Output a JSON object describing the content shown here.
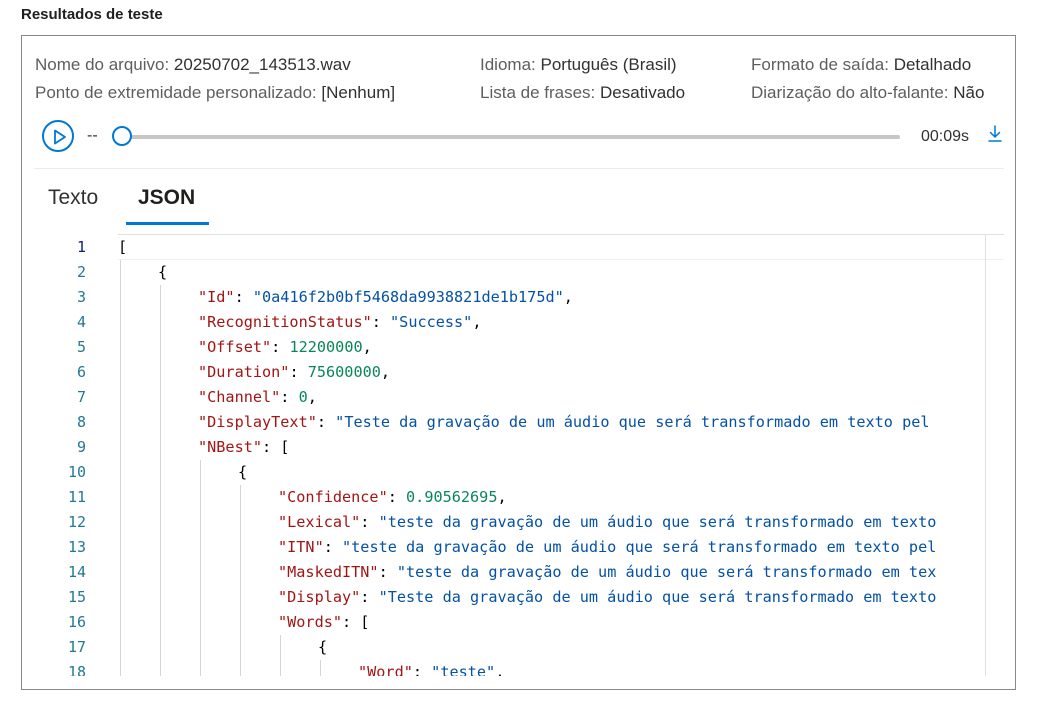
{
  "section_title": "Resultados de teste",
  "meta": {
    "file_label": "Nome do arquivo:",
    "file_value": "20250702_143513.wav",
    "lang_label": "Idioma:",
    "lang_value": "Português (Brasil)",
    "format_label": "Formato de saída:",
    "format_value": "Detalhado",
    "endpoint_label": "Ponto de extremidade personalizado:",
    "endpoint_value": "[Nenhum]",
    "phrases_label": "Lista de frases:",
    "phrases_value": "Desativado",
    "diar_label": "Diarização do alto-falante:",
    "diar_value": "Não"
  },
  "player": {
    "current_time": "--",
    "duration": "00:09s",
    "progress": 0,
    "play_icon": "play-icon",
    "download_icon": "download-icon"
  },
  "tabs": [
    {
      "label": "Texto",
      "active": false
    },
    {
      "label": "JSON",
      "active": true
    }
  ],
  "editor": {
    "active_line": 1,
    "lines": [
      {
        "n": "1",
        "indent": 0,
        "tokens": [
          [
            "punc",
            "["
          ]
        ]
      },
      {
        "n": "2",
        "indent": 1,
        "tokens": [
          [
            "punc",
            "{"
          ]
        ]
      },
      {
        "n": "3",
        "indent": 2,
        "tokens": [
          [
            "key",
            "\"Id\""
          ],
          [
            "punc",
            ": "
          ],
          [
            "str",
            "\"0a416f2b0bf5468da9938821de1b175d\""
          ],
          [
            "punc",
            ","
          ]
        ]
      },
      {
        "n": "4",
        "indent": 2,
        "tokens": [
          [
            "key",
            "\"RecognitionStatus\""
          ],
          [
            "punc",
            ": "
          ],
          [
            "str",
            "\"Success\""
          ],
          [
            "punc",
            ","
          ]
        ]
      },
      {
        "n": "5",
        "indent": 2,
        "tokens": [
          [
            "key",
            "\"Offset\""
          ],
          [
            "punc",
            ": "
          ],
          [
            "num",
            "12200000"
          ],
          [
            "punc",
            ","
          ]
        ]
      },
      {
        "n": "6",
        "indent": 2,
        "tokens": [
          [
            "key",
            "\"Duration\""
          ],
          [
            "punc",
            ": "
          ],
          [
            "num",
            "75600000"
          ],
          [
            "punc",
            ","
          ]
        ]
      },
      {
        "n": "7",
        "indent": 2,
        "tokens": [
          [
            "key",
            "\"Channel\""
          ],
          [
            "punc",
            ": "
          ],
          [
            "num",
            "0"
          ],
          [
            "punc",
            ","
          ]
        ]
      },
      {
        "n": "8",
        "indent": 2,
        "tokens": [
          [
            "key",
            "\"DisplayText\""
          ],
          [
            "punc",
            ": "
          ],
          [
            "str",
            "\"Teste da gravação de um áudio que será transformado em texto pel"
          ]
        ]
      },
      {
        "n": "9",
        "indent": 2,
        "tokens": [
          [
            "key",
            "\"NBest\""
          ],
          [
            "punc",
            ": ["
          ]
        ]
      },
      {
        "n": "10",
        "indent": 3,
        "tokens": [
          [
            "punc",
            "{"
          ]
        ]
      },
      {
        "n": "11",
        "indent": 4,
        "tokens": [
          [
            "key",
            "\"Confidence\""
          ],
          [
            "punc",
            ": "
          ],
          [
            "num",
            "0.90562695"
          ],
          [
            "punc",
            ","
          ]
        ]
      },
      {
        "n": "12",
        "indent": 4,
        "tokens": [
          [
            "key",
            "\"Lexical\""
          ],
          [
            "punc",
            ": "
          ],
          [
            "str",
            "\"teste da gravação de um áudio que será transformado em texto"
          ]
        ]
      },
      {
        "n": "13",
        "indent": 4,
        "tokens": [
          [
            "key",
            "\"ITN\""
          ],
          [
            "punc",
            ": "
          ],
          [
            "str",
            "\"teste da gravação de um áudio que será transformado em texto pel"
          ]
        ]
      },
      {
        "n": "14",
        "indent": 4,
        "tokens": [
          [
            "key",
            "\"MaskedITN\""
          ],
          [
            "punc",
            ": "
          ],
          [
            "str",
            "\"teste da gravação de um áudio que será transformado em tex"
          ]
        ]
      },
      {
        "n": "15",
        "indent": 4,
        "tokens": [
          [
            "key",
            "\"Display\""
          ],
          [
            "punc",
            ": "
          ],
          [
            "str",
            "\"Teste da gravação de um áudio que será transformado em texto"
          ]
        ]
      },
      {
        "n": "16",
        "indent": 4,
        "tokens": [
          [
            "key",
            "\"Words\""
          ],
          [
            "punc",
            ": ["
          ]
        ]
      },
      {
        "n": "17",
        "indent": 5,
        "tokens": [
          [
            "punc",
            "{"
          ]
        ]
      },
      {
        "n": "18",
        "indent": 6,
        "tokens": [
          [
            "key",
            "\"Word\""
          ],
          [
            "punc",
            ": "
          ],
          [
            "str",
            "\"teste\""
          ],
          [
            "punc",
            ","
          ]
        ]
      }
    ]
  },
  "colors": {
    "accent": "#0078d4",
    "json_key": "#a31515",
    "json_string": "#0451a5",
    "json_number": "#098658",
    "line_number": "#237893"
  }
}
